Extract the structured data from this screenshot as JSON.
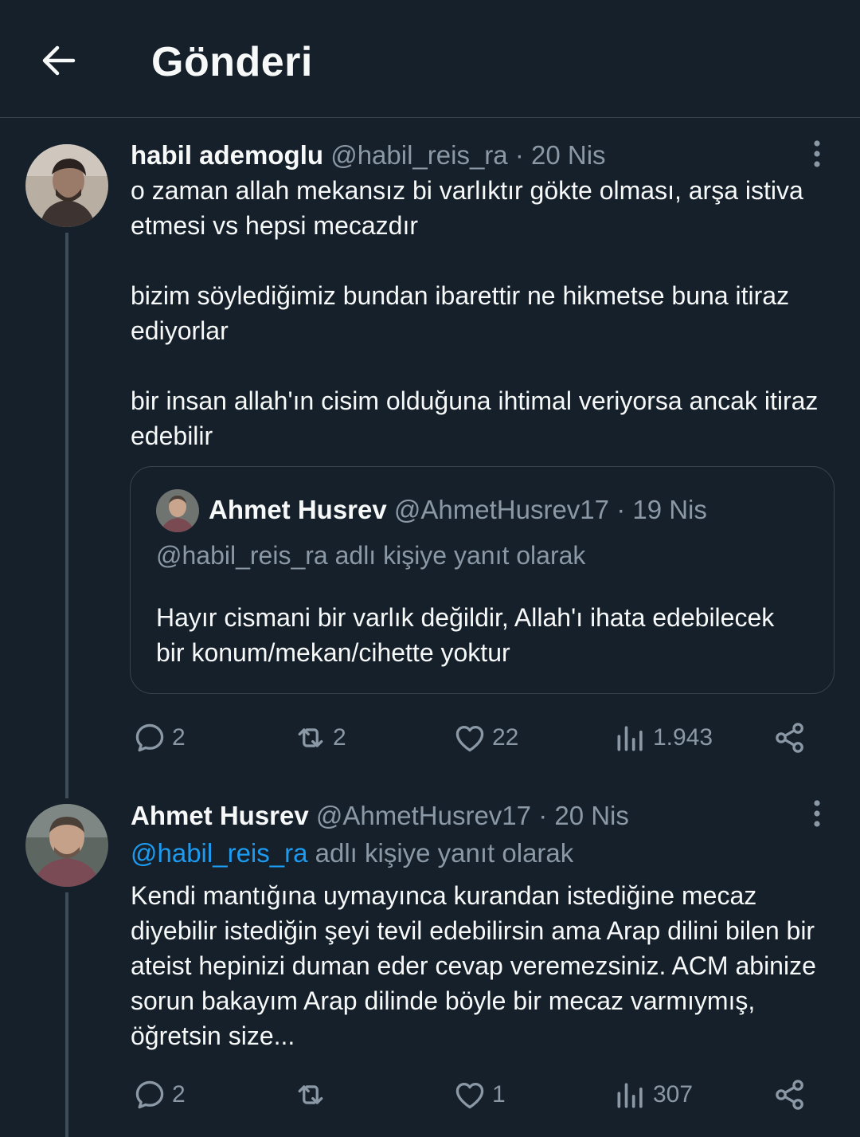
{
  "header": {
    "title": "Gönderi"
  },
  "post1": {
    "name": "habil ademoglu",
    "handle": "@habil_reis_ra",
    "date": "· 20 Nis",
    "paragraphs": [
      "o zaman allah mekansız bi varlıktır gökte olması, arşa istiva etmesi vs hepsi mecazdır",
      "bizim söylediğimiz bundan ibarettir ne hikmetse buna itiraz ediyorlar",
      "bir insan allah'ın cisim olduğuna ihtimal veriyorsa ancak itiraz edebilir"
    ],
    "quote": {
      "name": "Ahmet Husrev",
      "handle": "@AhmetHusrev17",
      "date": "· 19 Nis",
      "reply_to": "@habil_reis_ra adlı kişiye yanıt olarak",
      "text": "Hayır cismani bir varlık değildir, Allah'ı ihata edebilecek bir konum/mekan/cihette yoktur"
    },
    "stats": {
      "replies": "2",
      "reposts": "2",
      "likes": "22",
      "views": "1.943"
    }
  },
  "post2": {
    "name": "Ahmet Husrev",
    "handle": "@AhmetHusrev17",
    "date": "· 20 Nis",
    "reply_link": "@habil_reis_ra",
    "reply_suffix": "adlı kişiye yanıt olarak",
    "text": "Kendi mantığına uymayınca kurandan istediğine mecaz diyebilir istediğin şeyi tevil edebilirsin ama Arap dilini bilen bir ateist hepinizi duman eder cevap veremezsiniz. ACM abinize sorun bakayım Arap dilinde böyle bir mecaz varmıymış, öğretsin size...",
    "stats": {
      "replies": "2",
      "reposts": "",
      "likes": "1",
      "views": "307"
    }
  },
  "colors": {
    "background": "#15202b",
    "text": "#f7f9f9",
    "muted": "#8b98a5",
    "link": "#1d9bf0",
    "border": "#38444d"
  }
}
